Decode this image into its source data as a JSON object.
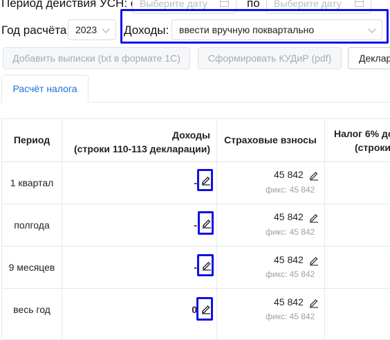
{
  "period_filter": {
    "label": "Период действия УСН: с",
    "from_placeholder": "Выберите дату",
    "to_label": "по",
    "to_placeholder": "Выберите дату"
  },
  "year": {
    "label": "Год расчёта:",
    "value": "2023"
  },
  "income": {
    "label": "Доходы:",
    "value": "ввести вручную поквартально"
  },
  "buttons": {
    "add_statements": "Добавить выписки (txt в формате 1С)",
    "generate_kudir": "Сформировать КУДиР (pdf)",
    "declaration": "Деклар"
  },
  "tabs": [
    {
      "label": "Расчёт налога"
    }
  ],
  "table": {
    "headers": {
      "period": "Период",
      "income_line1": "Доходы",
      "income_line2": "(строки 110-113 декларации)",
      "insurance": "Страховые взносы",
      "tax_line1": "Налог 6% до",
      "tax_line2": "(строки"
    },
    "rows": [
      {
        "period": "1 квартал",
        "income": "-",
        "insurance": "45 842",
        "insurance_fixed": "фикс: 45 842"
      },
      {
        "period": "полгода",
        "income": "-",
        "insurance": "45 842",
        "insurance_fixed": "фикс: 45 842"
      },
      {
        "period": "9 месяцев",
        "income": "-",
        "insurance": "45 842",
        "insurance_fixed": "фикс: 45 842"
      },
      {
        "period": "весь год",
        "income": "0",
        "insurance": "45 842",
        "insurance_fixed": "фикс: 45 842"
      }
    ]
  },
  "colors": {
    "accent": "#1a6fdc",
    "highlight": "#1010e8"
  }
}
